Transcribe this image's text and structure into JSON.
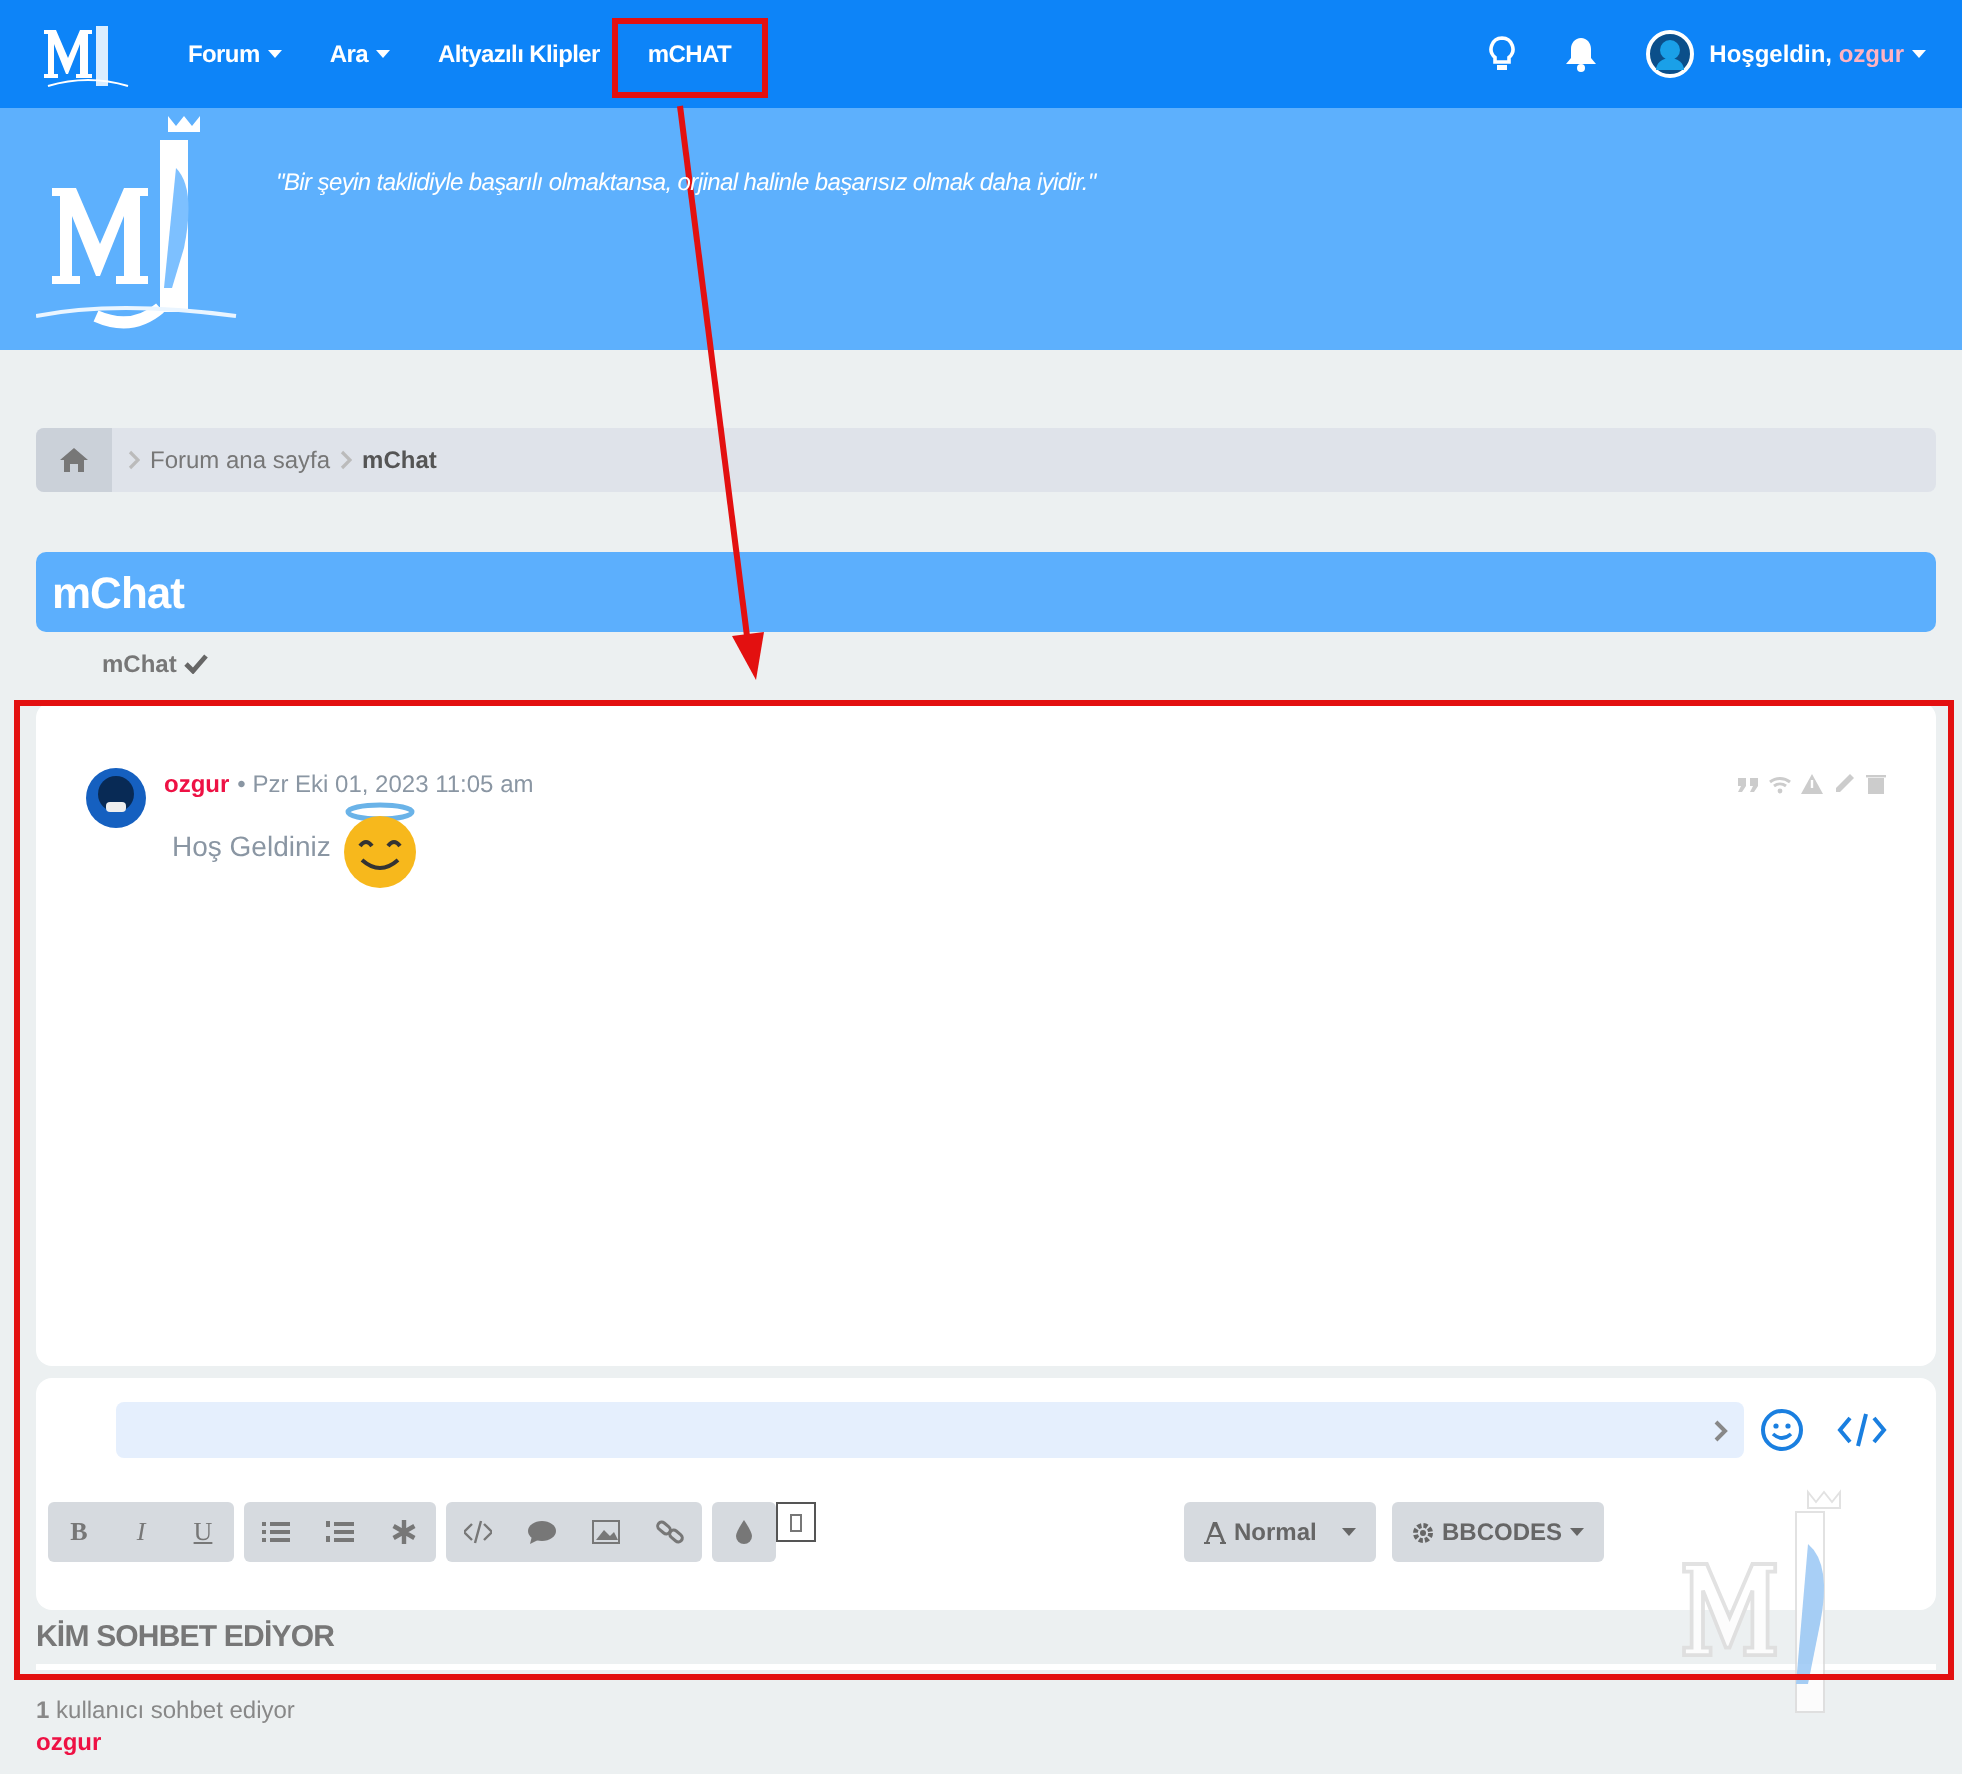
{
  "navbar": {
    "items": [
      {
        "label": "Forum",
        "dropdown": true
      },
      {
        "label": "Ara",
        "dropdown": true
      },
      {
        "label": "Altyazılı Klipler",
        "dropdown": false
      },
      {
        "label": "mCHAT",
        "dropdown": false
      }
    ],
    "greeting": "Hoşgeldin,",
    "username": "ozgur"
  },
  "banner": {
    "quote": "\"Bir şeyin taklidiyle başarılı olmaktansa, orjinal halinle başarısız olmak daha iyidir.\""
  },
  "breadcrumb": [
    "Forum ana sayfa",
    "mChat"
  ],
  "page_title": "mChat",
  "subnav": {
    "label": "mChat"
  },
  "messages": [
    {
      "author": "ozgur",
      "time": "• Pzr Eki 01, 2023 11:05 am",
      "text": "Hoş Geldiniz"
    }
  ],
  "editor": {
    "format_buttons": [
      "B",
      "I",
      "U"
    ],
    "dropdowns": [
      "Normal",
      "BBCODES"
    ]
  },
  "who_is_chatting": {
    "title": "KİM SOHBET EDİYOR",
    "count_line": "**1** kullanıcı sohbet ediyor",
    "users": [
      "ozgur"
    ]
  }
}
